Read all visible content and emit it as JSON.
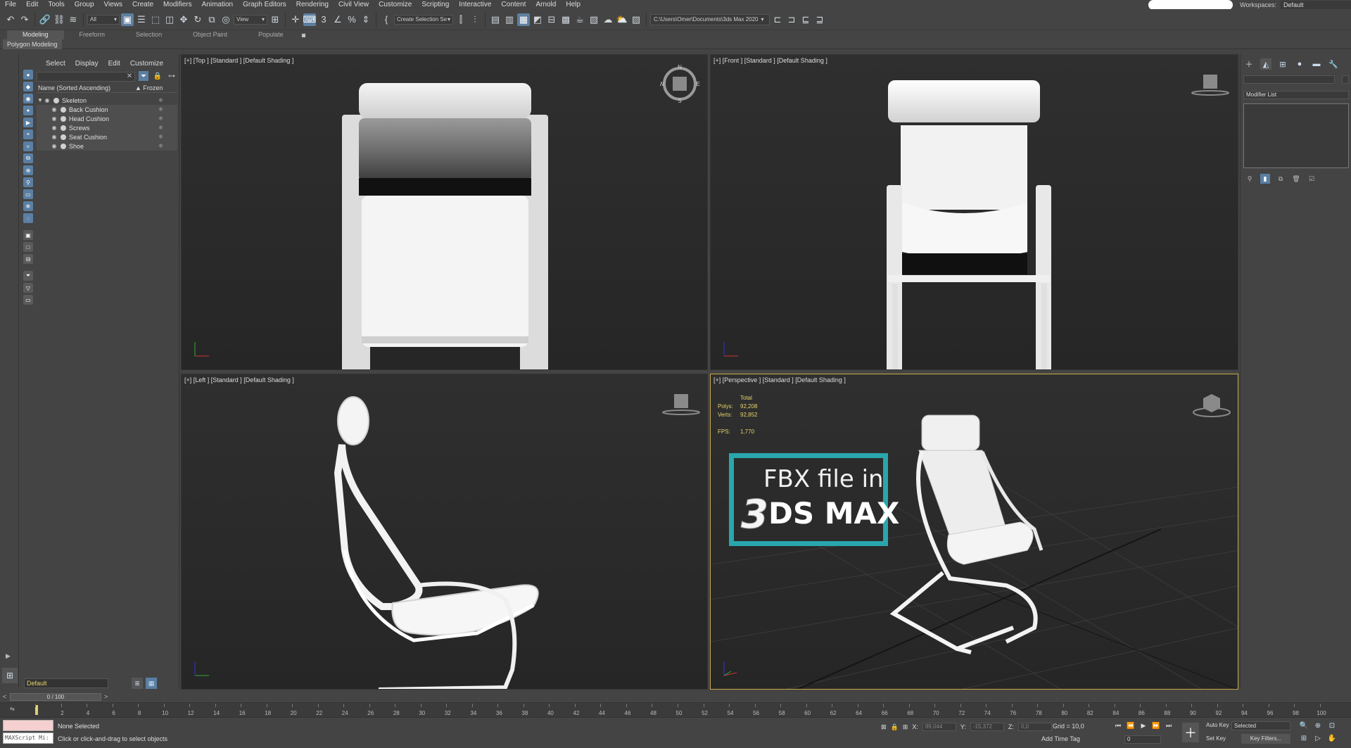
{
  "menu": [
    "File",
    "Edit",
    "Tools",
    "Group",
    "Views",
    "Create",
    "Modifiers",
    "Animation",
    "Graph Editors",
    "Rendering",
    "Civil View",
    "Customize",
    "Scripting",
    "Interactive",
    "Content",
    "Arnold",
    "Help"
  ],
  "workspace": {
    "label": "Workspaces:",
    "value": "Default"
  },
  "toolbar": {
    "selection_filter": "All",
    "ref_coord": "View",
    "named_selection": "Create Selection Se",
    "project_path": "C:\\Users\\Omer\\Documents\\3ds Max 2020"
  },
  "ribbon": {
    "tabs": [
      "Modeling",
      "Freeform",
      "Selection",
      "Object Paint",
      "Populate"
    ],
    "panel": "Polygon Modeling"
  },
  "scene_explorer": {
    "menu": [
      "Select",
      "Display",
      "Edit",
      "Customize"
    ],
    "col_name": "Name (Sorted Ascending)",
    "col_frozen": "▲ Frozen",
    "root": "Skeleton",
    "children": [
      "Back Cushion",
      "Head Cushion",
      "Screws",
      "Seat Cushion",
      "Shoe"
    ],
    "layer": "Default"
  },
  "viewports": {
    "top": "[+] [Top ] [Standard ] [Default Shading ]",
    "front": "[+] [Front ] [Standard ] [Default Shading ]",
    "left": "[+] [Left ] [Standard ] [Default Shading ]",
    "perspective": "[+] [Perspective ] [Standard ] [Default Shading ]"
  },
  "compass": {
    "n": "N",
    "s": "S",
    "e": "E",
    "w": "W"
  },
  "stats": {
    "total_label": "Total",
    "polys_label": "Polys:",
    "polys": "92,208",
    "verts_label": "Verts:",
    "verts": "92,852",
    "fps_label": "FPS:",
    "fps": "1,770"
  },
  "badge": {
    "line1": "FBX file in",
    "big3": "3",
    "line2": "DS MAX",
    "color": "#2aa6ad"
  },
  "command_panel": {
    "modifier_list": "Modifier List"
  },
  "timeline": {
    "slider": "0 / 100",
    "ticks": [
      0,
      2,
      4,
      6,
      8,
      10,
      12,
      14,
      16,
      18,
      20,
      22,
      24,
      26,
      28,
      30,
      32,
      34,
      36,
      38,
      40,
      42,
      44,
      46,
      48,
      50,
      52,
      54,
      56,
      58,
      60,
      62,
      64,
      66,
      68,
      70,
      72,
      74,
      76,
      78,
      80,
      82,
      84,
      86,
      88,
      90,
      92,
      94,
      96,
      98,
      100
    ]
  },
  "status": {
    "selection": "None Selected",
    "prompt": "Click or click-and-drag to select objects",
    "maxscript": "MAXScript Mi:",
    "x_label": "X:",
    "x": "89,044",
    "y_label": "Y:",
    "y": "-15,372",
    "z_label": "Z:",
    "z": "0,0",
    "grid": "Grid = 10,0",
    "add_time_tag": "Add Time Tag",
    "frame": "0",
    "auto_key": "Auto Key",
    "set_key": "Set Key",
    "key_mode": "Selected",
    "key_filters": "Key Filters..."
  }
}
